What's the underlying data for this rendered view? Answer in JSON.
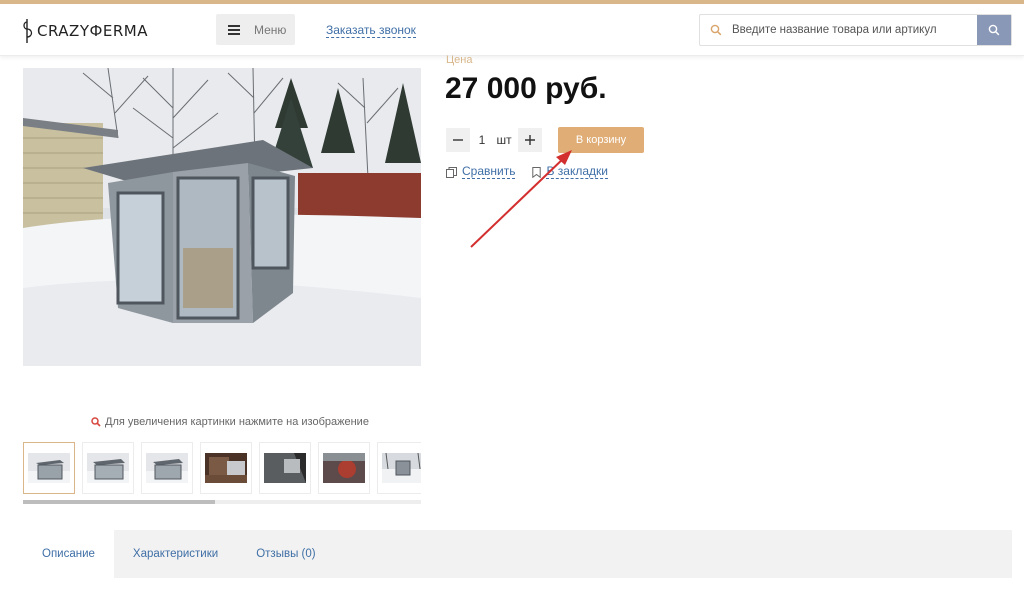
{
  "header": {
    "logo_text": "CRAZYФERMA",
    "menu_label": "Меню",
    "callback_link": "Заказать звонок",
    "search_placeholder": "Введите название товара или артикул",
    "accent_color": "#d9b78b"
  },
  "gallery": {
    "zoom_hint": "Для увеличения картинки нажмите на изображение",
    "thumbnails": [
      "thumb-1",
      "thumb-2",
      "thumb-3",
      "thumb-4",
      "thumb-5",
      "thumb-6",
      "thumb-7"
    ],
    "active_thumbnail": 0
  },
  "product": {
    "price_label": "Цена",
    "price": "27 000 руб.",
    "quantity": "1",
    "unit": "шт",
    "add_to_cart": "В корзину",
    "compare": "Сравнить",
    "bookmark": "В закладки",
    "cart_color": "#e0ad76"
  },
  "tabs": [
    {
      "label": "Описание",
      "active": true
    },
    {
      "label": "Характеристики",
      "active": false
    },
    {
      "label": "Отзывы (0)",
      "active": false
    }
  ]
}
